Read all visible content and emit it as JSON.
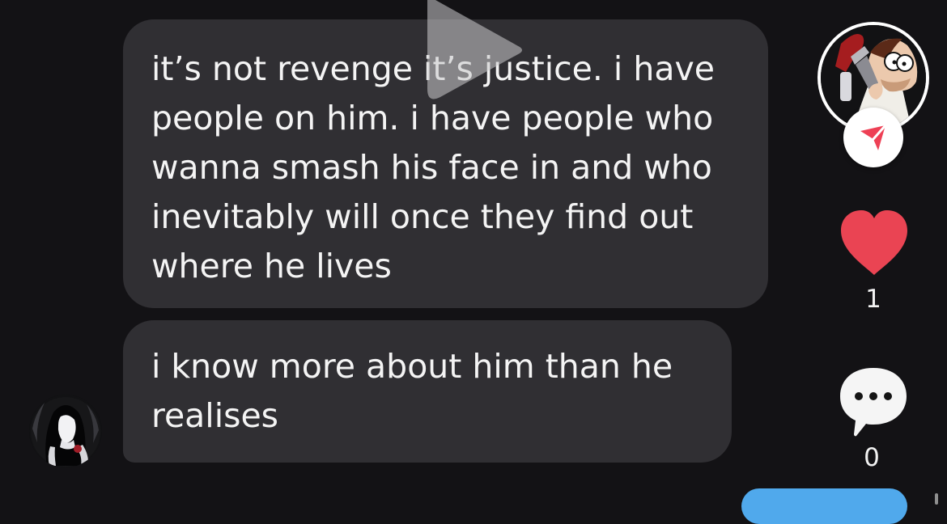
{
  "messages": [
    {
      "lines": [
        "it’s not revenge it’s justice. i have",
        "people on him. i have people who",
        "wanna smash his face in and who",
        "inevitably will once they find out",
        "where he lives"
      ]
    },
    {
      "lines": [
        "i know more about him than he",
        "realises"
      ]
    }
  ],
  "actions": {
    "likes": "1",
    "comments": "0"
  },
  "colors": {
    "background": "#131215",
    "bubble": "#302f33",
    "text": "#f4f4f4",
    "like": "#ea4453",
    "share_badge": "#ee4055",
    "action_pill": "#50a9ec"
  },
  "icons": {
    "play": "play-icon",
    "share": "send-icon",
    "like": "heart-icon",
    "comment": "comment-bubble-icon"
  }
}
